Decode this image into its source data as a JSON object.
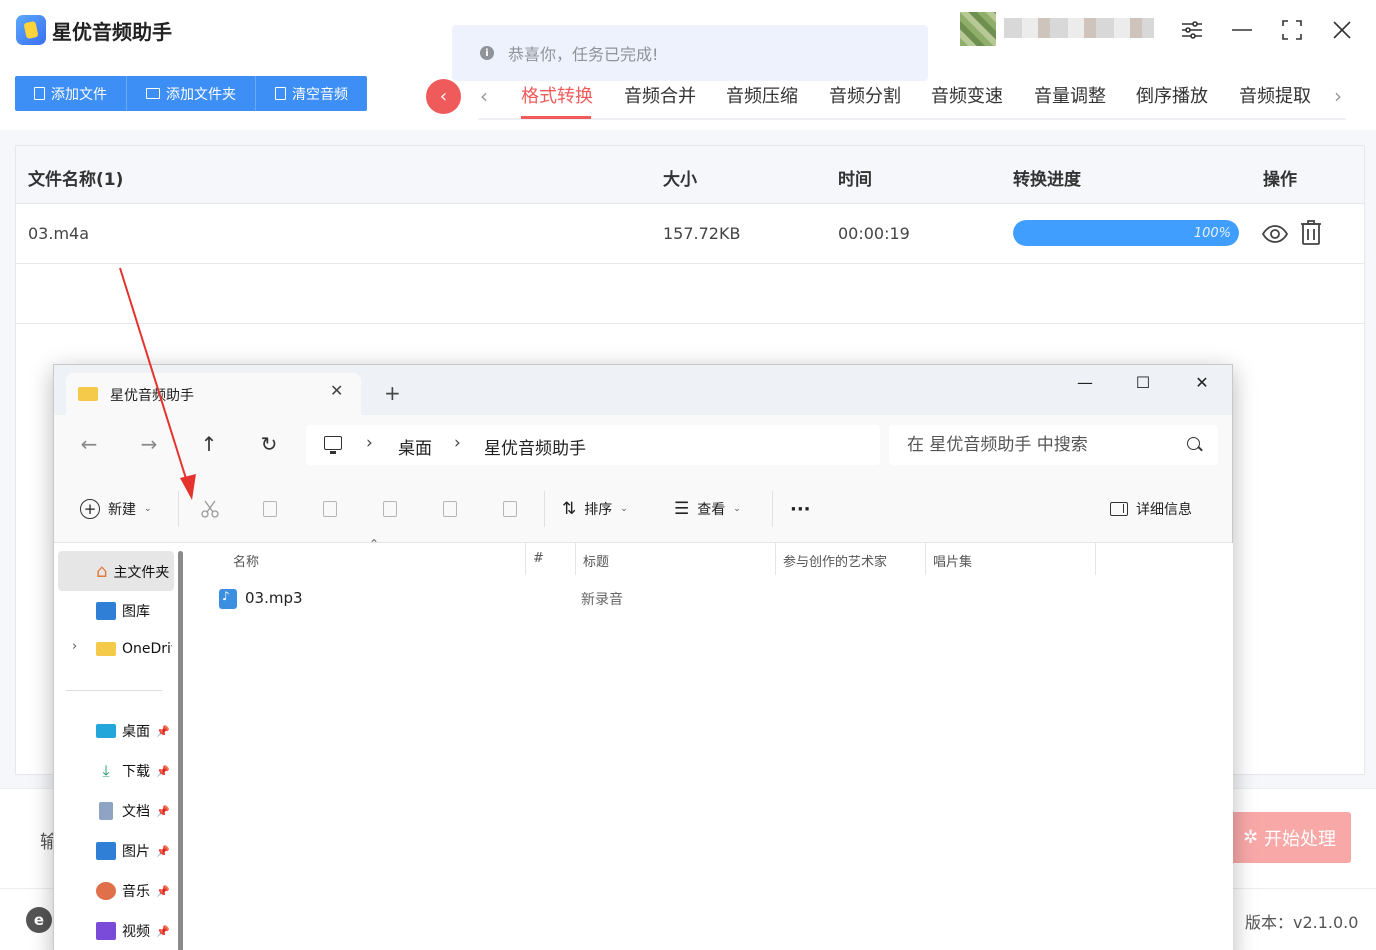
{
  "app": {
    "title": "星优音频助手",
    "toolbar": {
      "add_file": "添加文件",
      "add_folder": "添加文件夹",
      "clear_audio": "清空音频"
    },
    "tabs": [
      "格式转换",
      "音频合并",
      "音频压缩",
      "音频分割",
      "音频变速",
      "音量调整",
      "倒序播放",
      "音频提取"
    ],
    "active_tab": "格式转换",
    "toast": "恭喜你，任务已完成!",
    "table": {
      "headers": {
        "name": "文件名称(1)",
        "size": "大小",
        "time": "时间",
        "progress": "转换进度",
        "actions": "操作"
      },
      "rows": [
        {
          "name": "03.m4a",
          "size": "157.72KB",
          "time": "00:00:19",
          "progress": 1.0,
          "progress_label": "100%"
        }
      ]
    },
    "output_label": "输",
    "start_button": "开始处理",
    "version": "版本：v2.1.0.0",
    "colors": {
      "accent": "#3d8ef5",
      "tab_active": "#ef5b5b",
      "progress": "#409eff",
      "start_button": "#f9a8a8"
    }
  },
  "explorer": {
    "tab_title": "星优音频助手",
    "breadcrumb": [
      "桌面",
      "星优音频助手"
    ],
    "search_placeholder": "在 星优音频助手 中搜索",
    "commands": {
      "new": "新建",
      "sort": "排序",
      "view": "查看",
      "details": "详细信息",
      "more": "···"
    },
    "nav": {
      "home": "主文件夹",
      "gallery": "图库",
      "onedrive": "OneDrive",
      "desktop": "桌面",
      "downloads": "下载",
      "documents": "文档",
      "pictures": "图片",
      "music": "音乐",
      "videos": "视频"
    },
    "columns": {
      "name": "名称",
      "number": "#",
      "title": "标题",
      "artist": "参与创作的艺术家",
      "album": "唱片集"
    },
    "files": [
      {
        "name": "03.mp3",
        "title": "新录音"
      }
    ]
  }
}
